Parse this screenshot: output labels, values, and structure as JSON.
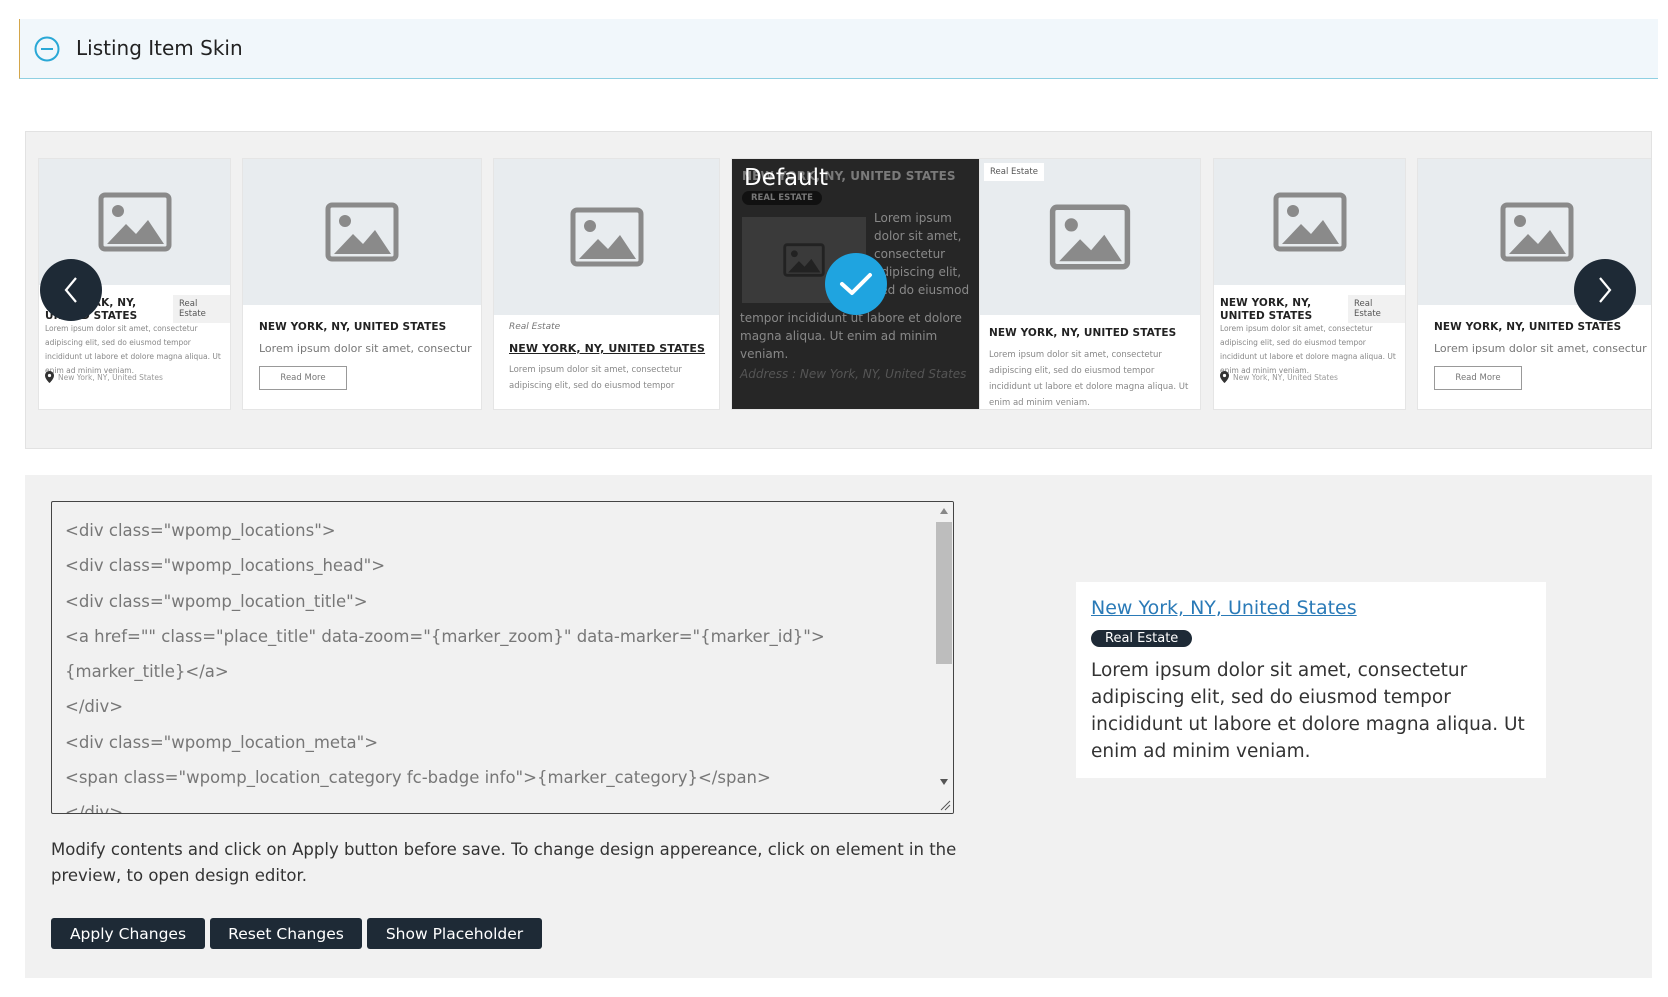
{
  "header": {
    "title": "Listing Item Skin"
  },
  "carousel": {
    "cards": [
      {
        "title": "NEW YORK, NY, UNITED STATES",
        "category": "Real Estate",
        "body": "Lorem ipsum dolor sit amet, consectetur adipiscing elit, sed do eiusmod tempor incididunt ut labore et dolore magna aliqua. Ut enim ad minim veniam.",
        "address": "New York, NY, United States"
      },
      {
        "title": "NEW YORK, NY, UNITED STATES",
        "body": "Lorem ipsum dolor sit amet, consectur",
        "read_more": "Read More"
      },
      {
        "category": "Real Estate",
        "title": "NEW YORK, NY, UNITED STATES",
        "body": "Lorem ipsum dolor sit amet, consectetur adipiscing elit, sed do eiusmod tempor"
      },
      {
        "label": "Default",
        "title": "NEW YORK, NY, UNITED STATES",
        "category": "REAL ESTATE",
        "side_text": "Lorem ipsum dolor sit amet, consectetur adipiscing elit, sed do eiusmod",
        "body": "tempor incididunt ut labore et dolore magna aliqua. Ut enim ad minim veniam.",
        "address": "Address : New York, NY, United States"
      },
      {
        "category": "Real Estate",
        "title": "NEW YORK, NY, UNITED STATES",
        "body": "Lorem ipsum dolor sit amet, consectetur adipiscing elit, sed do eiusmod tempor incididunt ut labore et dolore magna aliqua. Ut enim ad minim veniam."
      },
      {
        "title": "NEW YORK, NY, UNITED STATES",
        "category": "Real Estate",
        "body": "Lorem ipsum dolor sit amet, consectetur adipiscing elit, sed do eiusmod tempor incididunt ut labore et dolore magna aliqua. Ut enim ad minim veniam.",
        "address": "New York, NY, United States"
      },
      {
        "title": "NEW YORK, NY, UNITED STATES",
        "body": "Lorem ipsum dolor sit amet, consectur",
        "read_more": "Read More"
      }
    ]
  },
  "editor": {
    "code_lines": [
      "<div class=\"wpomp_locations\">",
      "<div class=\"wpomp_locations_head\">",
      "<div class=\"wpomp_location_title\">",
      "<a href=\"\" class=\"place_title\" data-zoom=\"{marker_zoom}\" data-marker=\"{marker_id}\">",
      "{marker_title}</a>",
      "</div>",
      "<div class=\"wpomp_location_meta\">",
      "<span class=\"wpomp_location_category fc-badge info\">{marker_category}</span>",
      "</div>"
    ],
    "help_text": "Modify contents and click on Apply button before save. To change design appereance, click on element in the preview, to open design editor.",
    "buttons": {
      "apply": "Apply Changes",
      "reset": "Reset Changes",
      "placeholder": "Show Placeholder"
    }
  },
  "preview": {
    "title": "New York, NY, United States",
    "badge": "Real Estate",
    "description": "Lorem ipsum dolor sit amet, consectetur adipiscing elit, sed do eiusmod tempor incididunt ut labore et dolore magna aliqua. Ut enim ad minim veniam."
  },
  "colors": {
    "accent": "#1fa4e0",
    "dark": "#1e2a36",
    "link": "#2a7ab7"
  }
}
